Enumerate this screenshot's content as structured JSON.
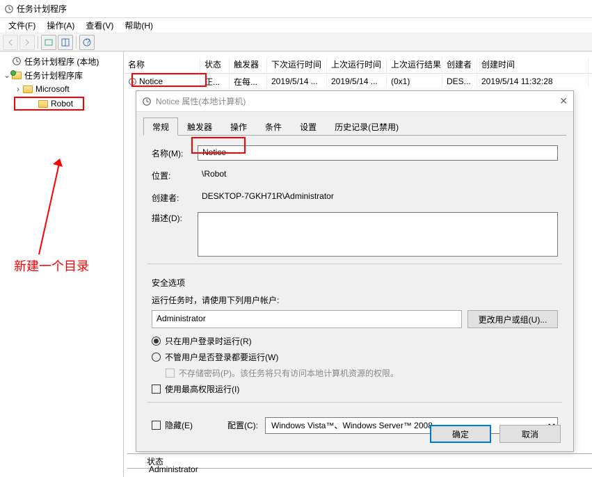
{
  "window": {
    "title": "任务计划程序"
  },
  "menu": {
    "file": "文件(F)",
    "action": "操作(A)",
    "view": "查看(V)",
    "help": "帮助(H)"
  },
  "tree": {
    "root": "任务计划程序 (本地)",
    "library": "任务计划程序库",
    "microsoft": "Microsoft",
    "robot": "Robot"
  },
  "annotation": "新建一个目录",
  "list": {
    "headers": {
      "name": "名称",
      "status": "状态",
      "trigger": "触发器",
      "next": "下次运行时间",
      "last": "上次运行时间",
      "lastres": "上次运行结果",
      "author": "创建者",
      "created": "创建时间"
    },
    "row": {
      "name": "Notice",
      "status": "正...",
      "trigger": "在每...",
      "next": "2019/5/14 ...",
      "last": "2019/5/14 ...",
      "lastres": "(0x1)",
      "author": "DES...",
      "created": "2019/5/14 11:32:28"
    }
  },
  "dialog": {
    "title": "Notice 属性(本地计算机)",
    "tabs": {
      "general": "常规",
      "triggers": "触发器",
      "actions": "操作",
      "conditions": "条件",
      "settings": "设置",
      "history": "历史记录(已禁用)"
    },
    "name_label": "名称(M):",
    "name_value": "Notice",
    "location_label": "位置:",
    "location_value": "\\Robot",
    "author_label": "创建者:",
    "author_value": "DESKTOP-7GKH71R\\Administrator",
    "desc_label": "描述(D):",
    "security_header": "安全选项",
    "runas_text": "运行任务时，请使用下列用户帐户:",
    "runas_user": "Administrator",
    "change_user_btn": "更改用户或组(U)...",
    "radio_logged": "只在用户登录时运行(R)",
    "radio_any": "不管用户是否登录都要运行(W)",
    "nopass": "不存储密码(P)。该任务将只有访问本地计算机资源的权限。",
    "highest": "使用最高权限运行(I)",
    "hidden": "隐藏(E)",
    "config_label": "配置(C):",
    "config_value": "Windows Vista™、Windows Server™ 2008",
    "ok": "确定",
    "cancel": "取消"
  },
  "footer": {
    "admin": "Administrator",
    "status": "状态"
  }
}
